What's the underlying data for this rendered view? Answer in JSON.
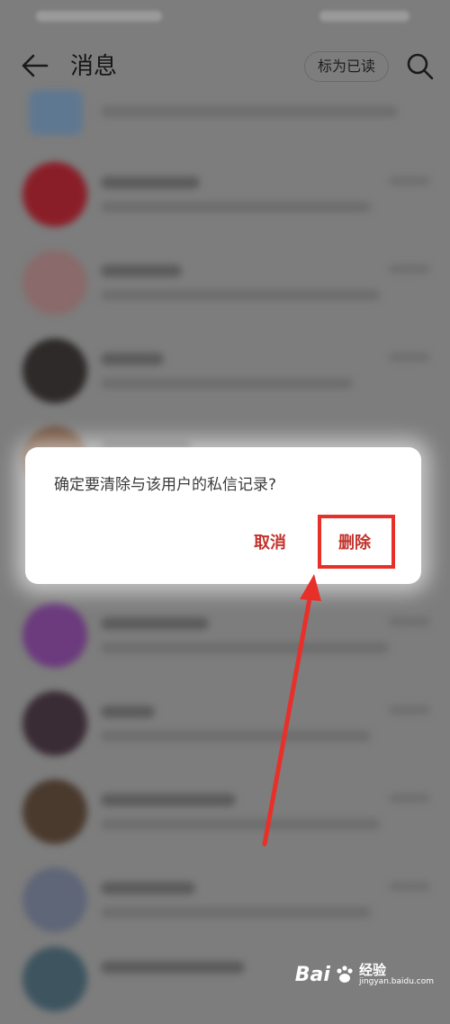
{
  "header": {
    "title": "消息",
    "mark_read_label": "标为已读",
    "back_icon": "back-arrow-icon",
    "search_icon": "search-icon"
  },
  "dialog": {
    "message": "确定要清除与该用户的私信记录?",
    "cancel_label": "取消",
    "delete_label": "删除"
  },
  "colors": {
    "accent": "#c3332c",
    "annotation": "#e8302a",
    "overlay": "#7d7d7d"
  },
  "watermark": {
    "brand": "Bai",
    "name": "经验",
    "url": "jingyan.baidu.com"
  }
}
